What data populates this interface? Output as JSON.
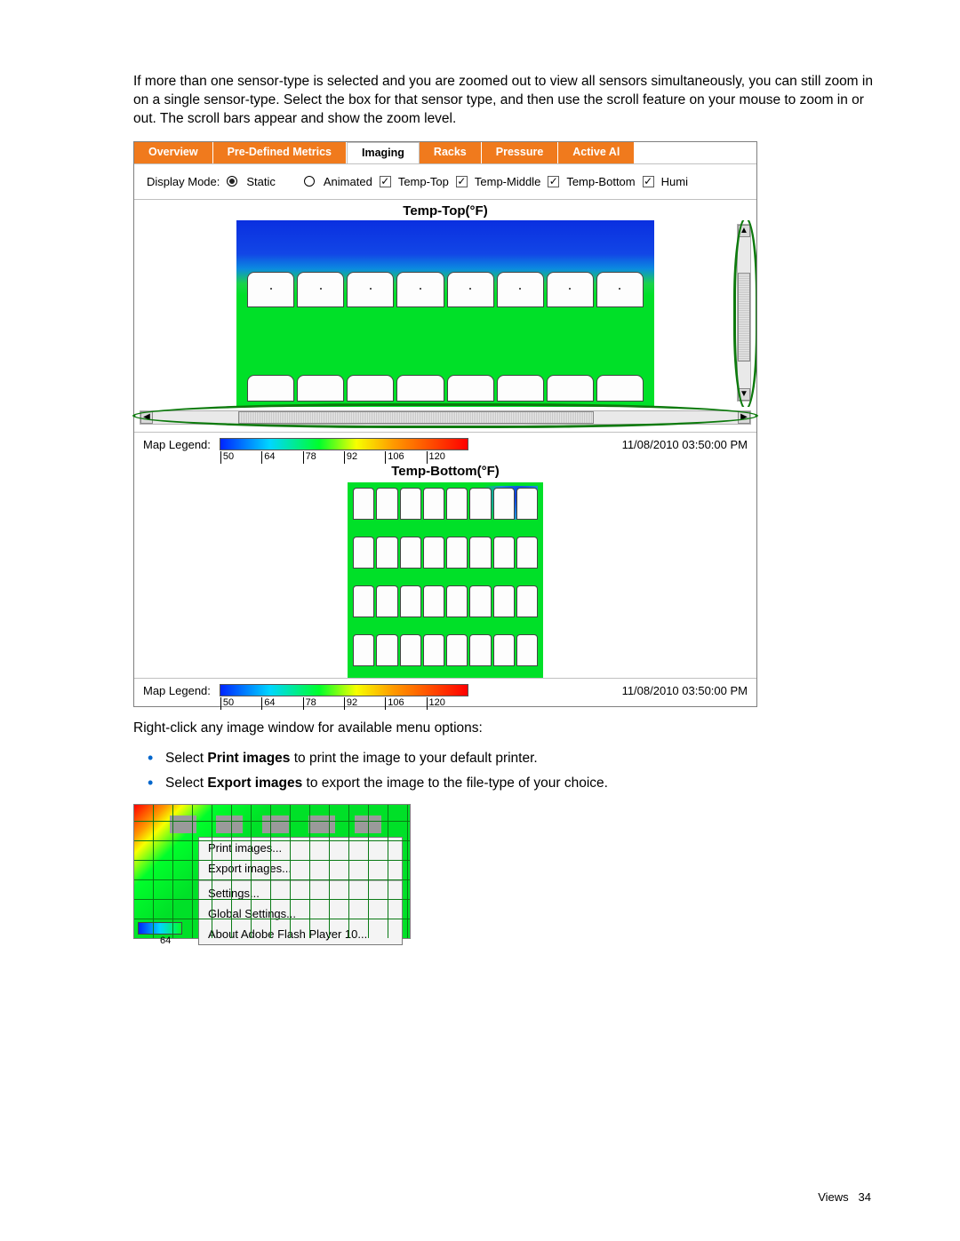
{
  "intro_text": "If more than one sensor-type is selected and you are zoomed out to view all sensors simultaneously, you can still zoom in on a single sensor-type. Select the box for that sensor type, and then use the scroll feature on your mouse to zoom in or out. The scroll bars appear and show the zoom level.",
  "tabs": {
    "overview": "Overview",
    "predefined": "Pre-Defined Metrics",
    "imaging": "Imaging",
    "racks": "Racks",
    "pressure": "Pressure",
    "active": "Active Al"
  },
  "toolbar": {
    "display_mode_label": "Display Mode:",
    "static": "Static",
    "animated": "Animated",
    "temp_top": "Temp-Top",
    "temp_middle": "Temp-Middle",
    "temp_bottom": "Temp-Bottom",
    "humi": "Humi"
  },
  "view_title_top": "Temp-Top(°F)",
  "view_title_bottom": "Temp-Bottom(°F)",
  "map_legend_label": "Map Legend:",
  "legend_ticks": {
    "t0": "50",
    "t1": "64",
    "t2": "78",
    "t3": "92",
    "t4": "106",
    "t5": "120"
  },
  "timestamp": "11/08/2010 03:50:00 PM",
  "rightclick_text": "Right-click any image window for available menu options:",
  "bullets": {
    "print_pre": "Select ",
    "print_bold": "Print images",
    "print_post": " to print the image to your default printer.",
    "export_pre": "Select ",
    "export_bold": "Export images",
    "export_post": " to export the image to the file-type of your choice."
  },
  "context_menu": {
    "print": "Print images...",
    "export": "Export images...",
    "settings": "Settings...",
    "global": "Global Settings...",
    "about": "About Adobe Flash Player 10..."
  },
  "ctx_tick": "64",
  "footer_label": "Views",
  "footer_page": "34"
}
